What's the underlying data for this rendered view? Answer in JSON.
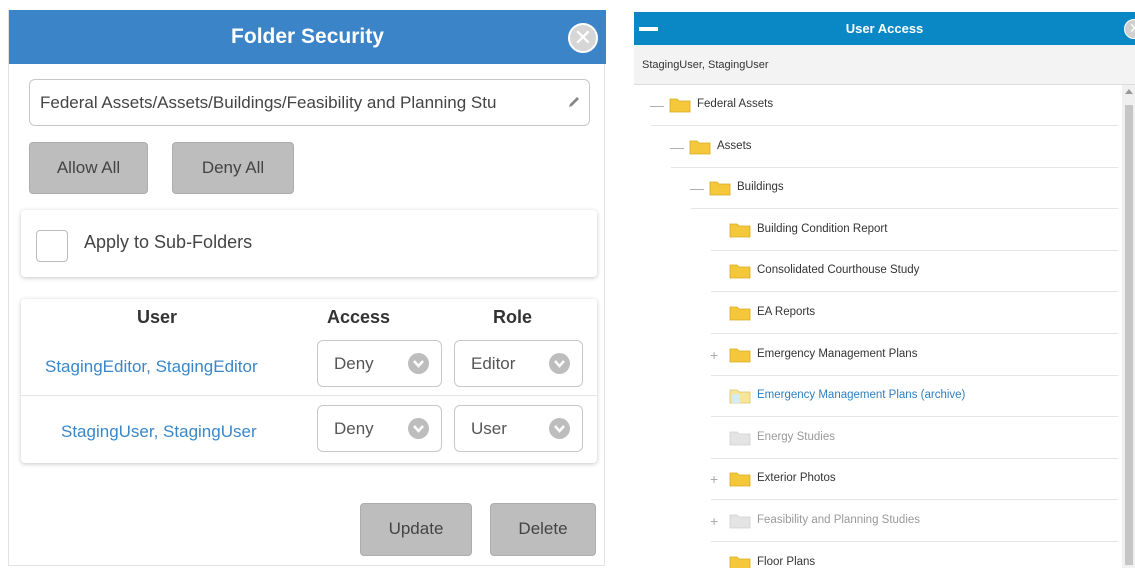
{
  "folder_security": {
    "title": "Folder Security",
    "path": "Federal Assets/Assets/Buildings/Feasibility and Planning Stu",
    "allow_all": "Allow All",
    "deny_all": "Deny All",
    "apply_subfolders": "Apply to Sub-Folders",
    "columns": [
      "User",
      "Access",
      "Role"
    ],
    "rows": [
      {
        "user": "StagingEditor, StagingEditor",
        "access": "Deny",
        "role": "Editor"
      },
      {
        "user": "StagingUser, StagingUser",
        "access": "Deny",
        "role": "User"
      }
    ],
    "update": "Update",
    "delete": "Delete"
  },
  "user_access": {
    "title": "User Access",
    "user": "StagingUser, StagingUser",
    "tree": [
      {
        "label": "Federal Assets",
        "toggle": "—",
        "state": "normal"
      },
      {
        "label": "Assets",
        "toggle": "—",
        "state": "normal"
      },
      {
        "label": "Buildings",
        "toggle": "—",
        "state": "normal"
      },
      {
        "label": "Building Condition Report",
        "toggle": "",
        "state": "normal"
      },
      {
        "label": "Consolidated Courthouse Study",
        "toggle": "",
        "state": "normal"
      },
      {
        "label": "EA Reports",
        "toggle": "",
        "state": "normal"
      },
      {
        "label": "Emergency Management Plans",
        "toggle": "+",
        "state": "normal"
      },
      {
        "label": "Emergency Management Plans (archive)",
        "toggle": "",
        "state": "active"
      },
      {
        "label": "Energy Studies",
        "toggle": "",
        "state": "dim"
      },
      {
        "label": "Exterior Photos",
        "toggle": "+",
        "state": "normal"
      },
      {
        "label": "Feasibility and Planning Studies",
        "toggle": "+",
        "state": "dim"
      },
      {
        "label": "Floor Plans",
        "toggle": "",
        "state": "normal"
      }
    ]
  },
  "colors": {
    "header_blue": "#3b84c8",
    "user_access_blue": "#0a88c6",
    "link_blue": "#3a87c8",
    "folder_yellow": "#f5c83c",
    "button_gray": "#bdbdbd"
  },
  "icons": [
    "close-icon",
    "pencil-icon",
    "chevron-down-icon",
    "minimize-icon",
    "folder-icon"
  ]
}
